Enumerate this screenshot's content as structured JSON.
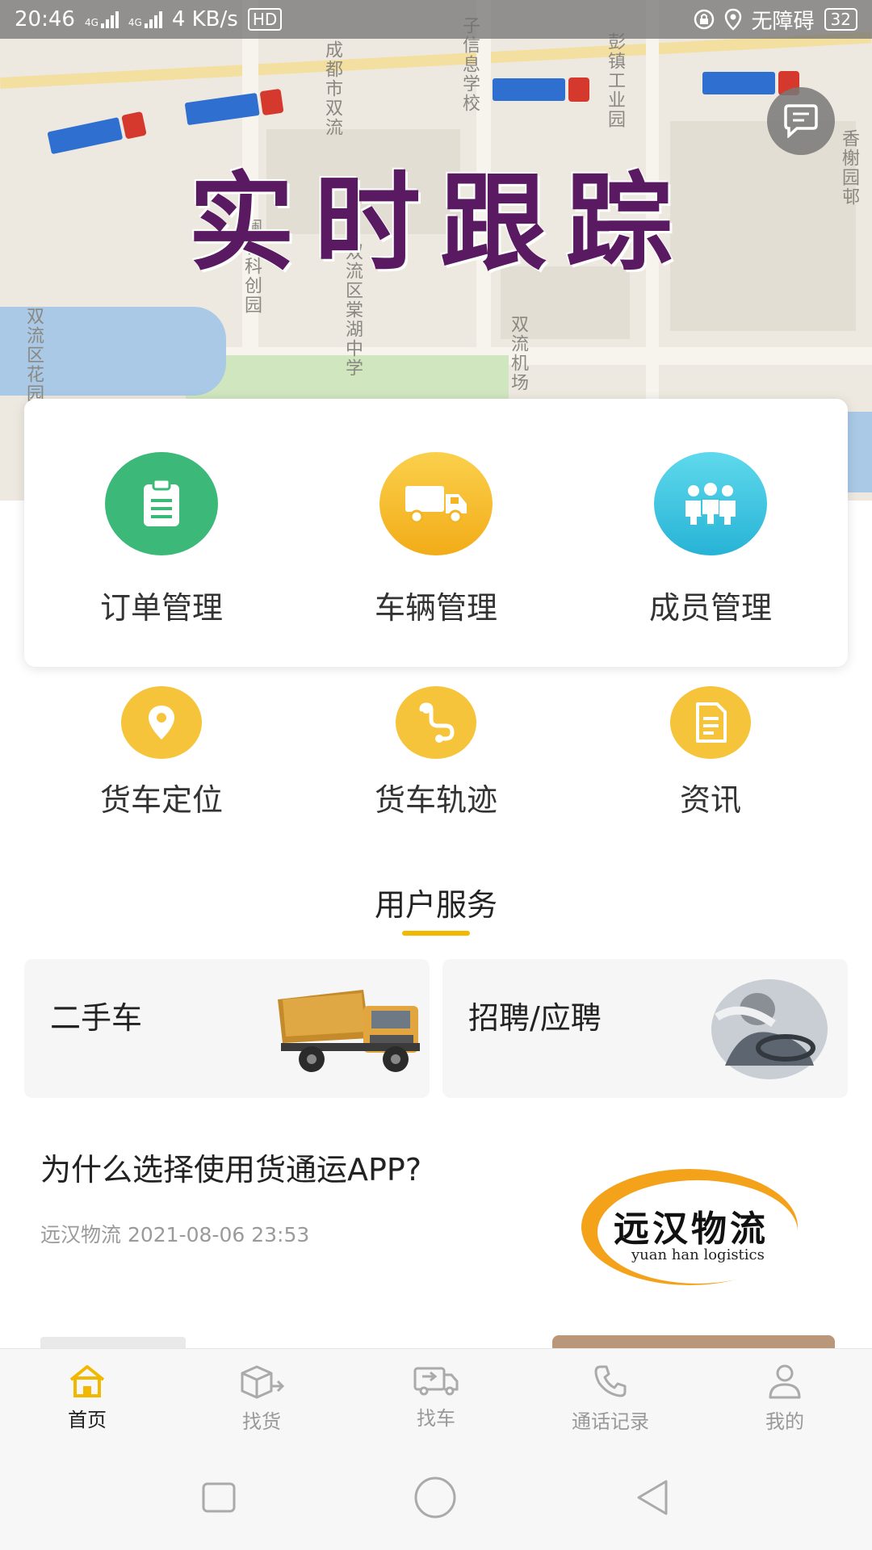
{
  "status_bar": {
    "time": "20:46",
    "network_1": "4G",
    "network_2": "4G",
    "speed": "4 KB/s",
    "hd": "HD",
    "accessibility": "无障碍",
    "battery": "32"
  },
  "banner": {
    "title": "实时跟踪",
    "map_labels": [
      "成都市双流",
      "子信息学校",
      "彭镇工业园",
      "澜谷科创园",
      "双流区棠湖中学",
      "双流机场",
      "香榭园邨",
      "双流区花园"
    ]
  },
  "main_features": [
    {
      "label": "订单管理",
      "icon": "clipboard-icon",
      "color": "#3cb878"
    },
    {
      "label": "车辆管理",
      "icon": "truck-icon",
      "color": "#f6bb2a"
    },
    {
      "label": "成员管理",
      "icon": "people-icon",
      "color": "#3cc3e0"
    }
  ],
  "sub_features": [
    {
      "label": "货车定位",
      "icon": "location-pin-icon"
    },
    {
      "label": "货车轨迹",
      "icon": "route-icon"
    },
    {
      "label": "资讯",
      "icon": "document-icon"
    }
  ],
  "section": {
    "title": "用户服务"
  },
  "services": [
    {
      "label": "二手车",
      "image": "dump-truck-image"
    },
    {
      "label": "招聘/应聘",
      "image": "driver-image"
    }
  ],
  "article": {
    "title": "为什么选择使用货通运APP?",
    "source": "远汉物流",
    "datetime": "2021-08-06 23:53",
    "logo_cn": "远汉物流",
    "logo_en": "yuan han logistics"
  },
  "tabs": [
    {
      "label": "首页",
      "icon": "home-icon",
      "active": true
    },
    {
      "label": "找货",
      "icon": "package-icon",
      "active": false
    },
    {
      "label": "找车",
      "icon": "van-icon",
      "active": false
    },
    {
      "label": "通话记录",
      "icon": "phone-icon",
      "active": false
    },
    {
      "label": "我的",
      "icon": "user-icon",
      "active": false
    }
  ],
  "colors": {
    "accent": "#f2b800",
    "banner_title": "#5a1a62"
  }
}
